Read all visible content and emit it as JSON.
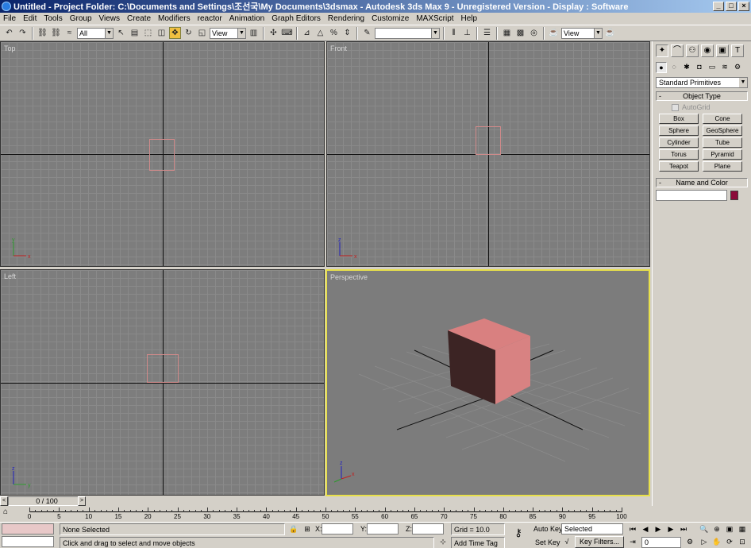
{
  "window": {
    "title": "Untitled    - Project Folder: C:\\Documents and Settings\\조선국\\My Documents\\3dsmax    - Autodesk 3ds Max 9  - Unregistered Version    - Display : Software"
  },
  "menu": [
    "File",
    "Edit",
    "Tools",
    "Group",
    "Views",
    "Create",
    "Modifiers",
    "reactor",
    "Animation",
    "Graph Editors",
    "Rendering",
    "Customize",
    "MAXScript",
    "Help"
  ],
  "toolbar": {
    "selection_filter": "All",
    "ref_coord_1": "View",
    "named_selection": "",
    "ref_coord_2": "View"
  },
  "viewports": {
    "top": "Top",
    "front": "Front",
    "left": "Left",
    "perspective": "Perspective"
  },
  "command_panel": {
    "category": "Standard Primitives",
    "object_type_title": "Object Type",
    "autogrid": "AutoGrid",
    "buttons": [
      "Box",
      "Cone",
      "Sphere",
      "GeoSphere",
      "Cylinder",
      "Tube",
      "Torus",
      "Pyramid",
      "Teapot",
      "Plane"
    ],
    "name_color_title": "Name and Color",
    "name_value": "",
    "color": "#8b0a3a"
  },
  "time": {
    "slider_label": "0 / 100",
    "ticks": [
      "0",
      "5",
      "10",
      "15",
      "20",
      "25",
      "30",
      "35",
      "40",
      "45",
      "50",
      "55",
      "60",
      "65",
      "70",
      "75",
      "80",
      "85",
      "90",
      "95",
      "100"
    ]
  },
  "status": {
    "selection": "None Selected",
    "prompt": "Click and drag to select and move objects",
    "x_label": "X:",
    "y_label": "Y:",
    "z_label": "Z:",
    "x_value": "",
    "y_value": "",
    "z_value": "",
    "grid": "Grid = 10.0",
    "add_time_tag": "Add Time Tag",
    "auto_key": "Auto Key",
    "set_key": "Set Key",
    "key_mode": "Selected",
    "key_filters": "Key Filters...",
    "frame": "0"
  },
  "colors": {
    "title_gradient_start": "#0a246a",
    "active_viewport_border": "#e8e04a",
    "box_color": "#d98080"
  }
}
